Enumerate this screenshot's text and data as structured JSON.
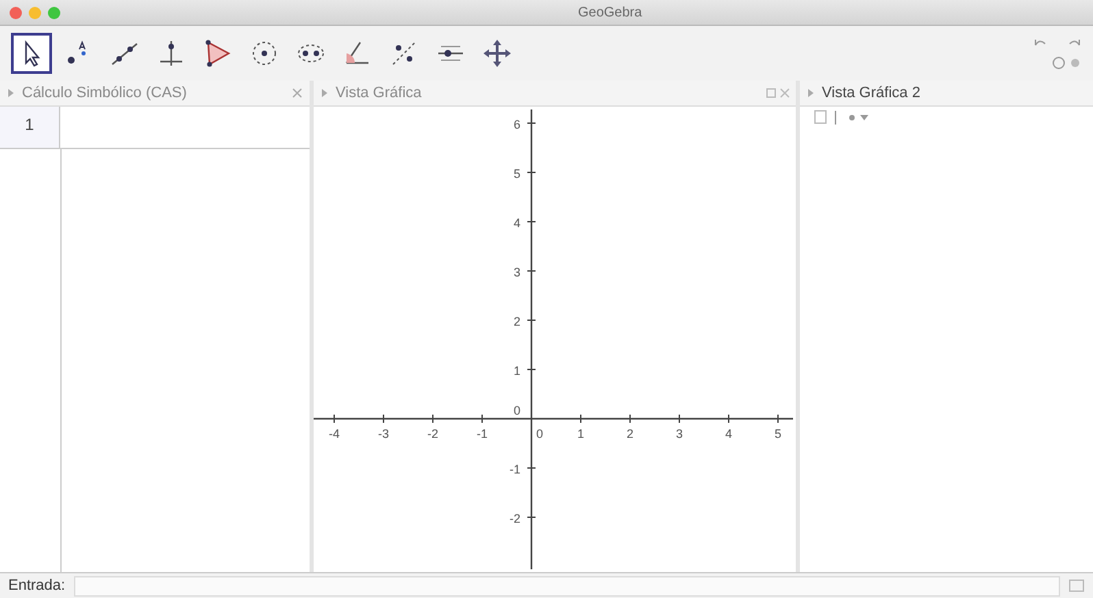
{
  "window": {
    "title": "GeoGebra"
  },
  "toolbar": {
    "tools": [
      {
        "kind": "move",
        "selected": true
      },
      {
        "kind": "point",
        "selected": false
      },
      {
        "kind": "line",
        "selected": false
      },
      {
        "kind": "perpendicular",
        "selected": false
      },
      {
        "kind": "polygon",
        "selected": false
      },
      {
        "kind": "circle",
        "selected": false
      },
      {
        "kind": "ellipse",
        "selected": false
      },
      {
        "kind": "angle",
        "selected": false
      },
      {
        "kind": "reflect",
        "selected": false
      },
      {
        "kind": "slider",
        "selected": false
      },
      {
        "kind": "pan",
        "selected": false
      }
    ]
  },
  "cas": {
    "title": "Cálculo Simbólico (CAS)",
    "rows": [
      {
        "number": "1"
      }
    ]
  },
  "graphics": {
    "title": "Vista Gráfica",
    "x_ticks": [
      "-4",
      "-3",
      "-2",
      "-1",
      "0",
      "1",
      "2",
      "3",
      "4",
      "5"
    ],
    "y_ticks": [
      "6",
      "5",
      "4",
      "3",
      "2",
      "1",
      "0",
      "-1",
      "-2"
    ]
  },
  "graphics2": {
    "title": "Vista Gráfica 2"
  },
  "input_bar": {
    "label": "Entrada:"
  }
}
